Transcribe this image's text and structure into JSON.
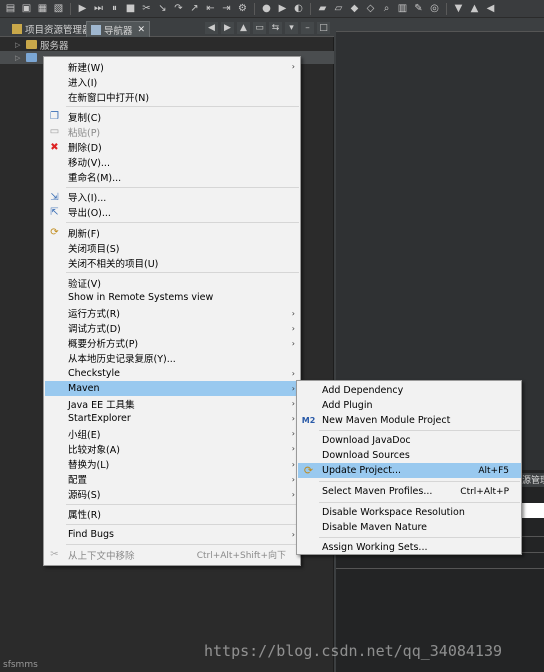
{
  "toolbar": {
    "icons": [
      "new-icon",
      "save-icon",
      "save-all-icon",
      "print-icon",
      "debug-icon",
      "skip-icon",
      "suspend-icon",
      "terminate-icon",
      "disconnect-icon",
      "step-into-icon",
      "step-over-icon",
      "step-return-icon",
      "drop-frame-icon",
      "use-step-filters-icon",
      "external-tools-icon",
      "run-debug-icon",
      "run-icon",
      "coverage-icon",
      "new-java-project-icon",
      "new-package-icon",
      "new-class-icon",
      "open-type-icon",
      "search-icon",
      "open-folder-icon",
      "brush-icon",
      "globe-icon",
      "next-annotation-icon",
      "prev-annotation-icon",
      "back-icon"
    ]
  },
  "panel": {
    "tabs": [
      {
        "label": "项目资源管理器",
        "active": false
      },
      {
        "label": "导航器",
        "active": true,
        "close": "✕"
      }
    ],
    "tree": [
      {
        "label": "服务器",
        "type": "folder"
      },
      {
        "label": "",
        "type": "project",
        "selected": true
      }
    ],
    "status": "sfsmms"
  },
  "context_menu": {
    "items": [
      {
        "label": "新建(W)",
        "submenu": true
      },
      {
        "label": "进入(I)"
      },
      {
        "label": "在新窗口中打开(N)"
      },
      {
        "sep": true
      },
      {
        "label": "复制(C)",
        "icon": "copy-icon"
      },
      {
        "label": "粘贴(P)",
        "icon": "paste-icon",
        "disabled": true
      },
      {
        "label": "删除(D)",
        "icon": "delete-icon"
      },
      {
        "label": "移动(V)..."
      },
      {
        "label": "重命名(M)..."
      },
      {
        "sep": true
      },
      {
        "label": "导入(I)...",
        "icon": "import-icon"
      },
      {
        "label": "导出(O)...",
        "icon": "export-icon"
      },
      {
        "sep": true
      },
      {
        "label": "刷新(F)",
        "icon": "refresh-icon"
      },
      {
        "label": "关闭项目(S)"
      },
      {
        "label": "关闭不相关的项目(U)"
      },
      {
        "sep": true
      },
      {
        "label": "验证(V)"
      },
      {
        "label": "Show in Remote Systems view"
      },
      {
        "label": "运行方式(R)",
        "submenu": true
      },
      {
        "label": "调试方式(D)",
        "submenu": true
      },
      {
        "label": "概要分析方式(P)",
        "submenu": true
      },
      {
        "label": "从本地历史记录复原(Y)..."
      },
      {
        "label": "Checkstyle",
        "submenu": true
      },
      {
        "label": "Maven",
        "submenu": true,
        "highlight": true
      },
      {
        "label": "Java EE 工具集",
        "submenu": true
      },
      {
        "label": "StartExplorer",
        "submenu": true
      },
      {
        "label": "小组(E)",
        "submenu": true
      },
      {
        "label": "比较对象(A)",
        "submenu": true
      },
      {
        "label": "替换为(L)",
        "submenu": true
      },
      {
        "label": "配置",
        "submenu": true
      },
      {
        "label": "源码(S)",
        "submenu": true
      },
      {
        "sep": true
      },
      {
        "label": "属性(R)"
      },
      {
        "sep": true
      },
      {
        "label": "Find Bugs",
        "submenu": true
      },
      {
        "sep": true
      },
      {
        "label": "从上下文中移除",
        "icon": "remove-context-icon",
        "disabled": true,
        "accel": "Ctrl+Alt+Shift+向下"
      }
    ]
  },
  "maven_submenu": {
    "items": [
      {
        "label": "Add Dependency"
      },
      {
        "label": "Add Plugin"
      },
      {
        "label": "New Maven Module Project",
        "icon": "maven-module-icon",
        "icon_text": "M2"
      },
      {
        "sep": true
      },
      {
        "label": "Download JavaDoc"
      },
      {
        "label": "Download Sources"
      },
      {
        "label": "Update Project...",
        "icon": "update-project-icon",
        "highlight": true,
        "accel": "Alt+F5"
      },
      {
        "sep": true
      },
      {
        "label": "Select Maven Profiles...",
        "accel": "Ctrl+Alt+P"
      },
      {
        "sep": true
      },
      {
        "label": "Disable Workspace Resolution"
      },
      {
        "label": "Disable Maven Nature"
      },
      {
        "sep": true
      },
      {
        "label": "Assign Working Sets..."
      }
    ]
  },
  "right_panel": {
    "tab_text": "源管理"
  },
  "watermark": "https://blog.csdn.net/qq_34084139"
}
